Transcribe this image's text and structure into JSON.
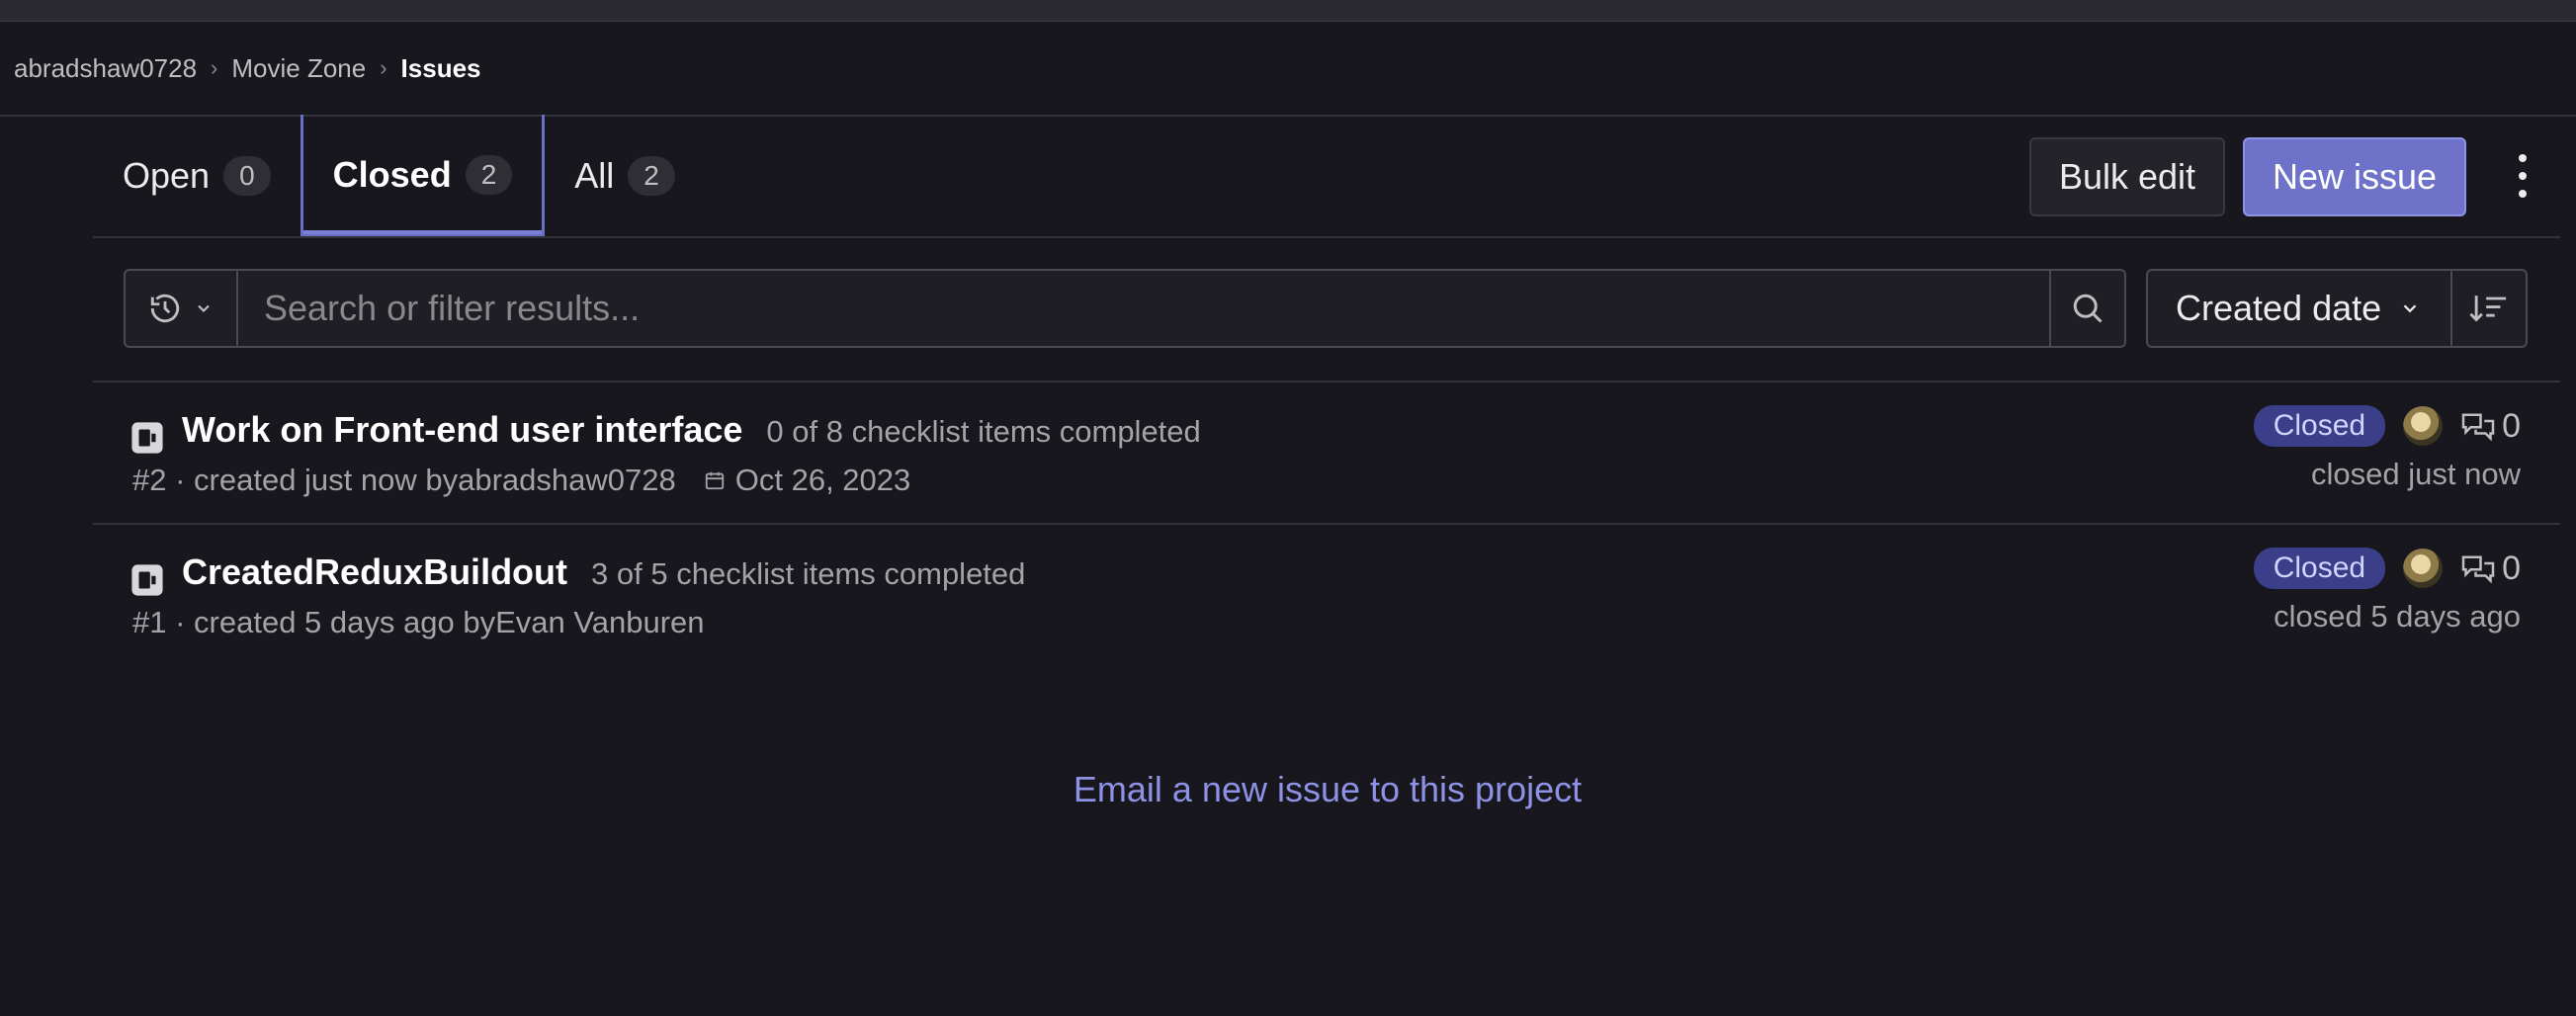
{
  "breadcrumb": {
    "user": "abradshaw0728",
    "project": "Movie Zone",
    "current": "Issues"
  },
  "tabs": [
    {
      "label": "Open",
      "count": "0"
    },
    {
      "label": "Closed",
      "count": "2"
    },
    {
      "label": "All",
      "count": "2"
    }
  ],
  "active_tab": "Closed",
  "actions": {
    "bulk_edit": "Bulk edit",
    "new_issue": "New issue"
  },
  "search": {
    "placeholder": "Search or filter results..."
  },
  "sort": {
    "label": "Created date"
  },
  "issues": [
    {
      "title": "Work on Front-end user interface",
      "checklist": "0 of 8 checklist items completed",
      "meta_prefix": "#2 · created just now by ",
      "author": "abradshaw0728",
      "due_date": "Oct 26, 2023",
      "status": "Closed",
      "comments": "0",
      "closed_time": "closed just now"
    },
    {
      "title": "CreatedReduxBuildout",
      "checklist": "3 of 5 checklist items completed",
      "meta_prefix": "#1 · created 5 days ago by ",
      "author": "Evan Vanburen",
      "status": "Closed",
      "comments": "0",
      "closed_time": "closed 5 days ago"
    }
  ],
  "footer": {
    "email_link": "Email a new issue to this project"
  },
  "colors": {
    "accent": "#6e73c9",
    "badge_bg": "#3b3f8a",
    "background": "#18171d"
  }
}
